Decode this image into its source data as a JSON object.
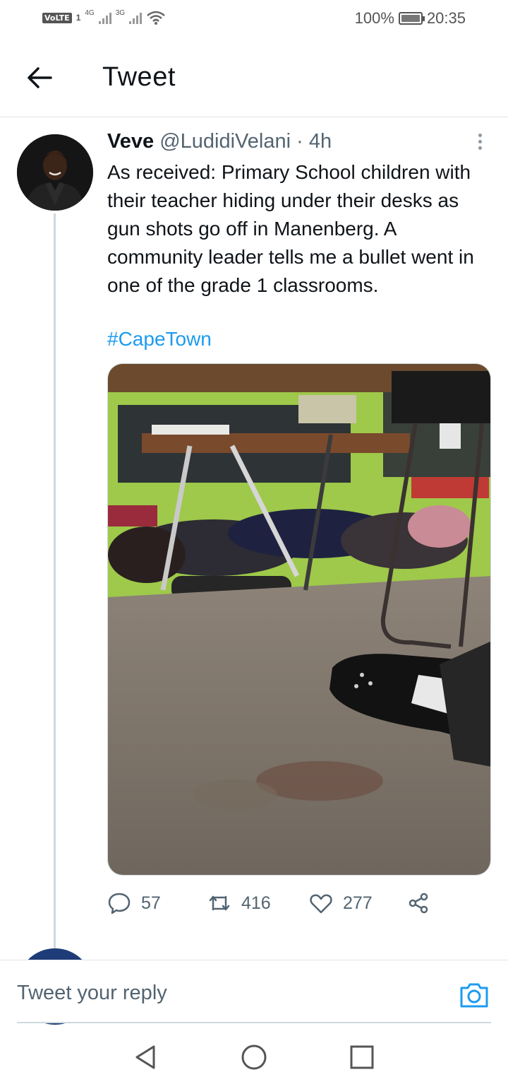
{
  "status_bar": {
    "volte": "VoLTE",
    "sim_number": "1",
    "network_1": "4G",
    "network_2": "3G",
    "battery_percent": "100%",
    "time": "20:35",
    "battery_level": 1.0
  },
  "header": {
    "back_icon": "arrow-left-icon",
    "title": "Tweet"
  },
  "tweet": {
    "display_name": "Veve",
    "handle": "@LudidiVelani",
    "dot": "·",
    "time": "4h",
    "text": "As received: Primary School children with their teacher hiding under their desks as gun shots go off in Manenberg. A community leader tells me a bullet went in one of the grade 1 classrooms.",
    "hashtag": "#CapeTown",
    "media_icon": "photo-classroom",
    "actions": {
      "replies": "57",
      "retweets": "416",
      "likes": "277"
    }
  },
  "reply_bar": {
    "placeholder": "Tweet your reply",
    "camera_icon": "camera-icon"
  },
  "nav_bar": {
    "back_icon": "triangle-back-icon",
    "home_icon": "circle-home-icon",
    "recents_icon": "square-recents-icon"
  },
  "colors": {
    "link_blue": "#1d9bf0",
    "secondary_text": "#536471",
    "divider": "#e1e4e8"
  }
}
